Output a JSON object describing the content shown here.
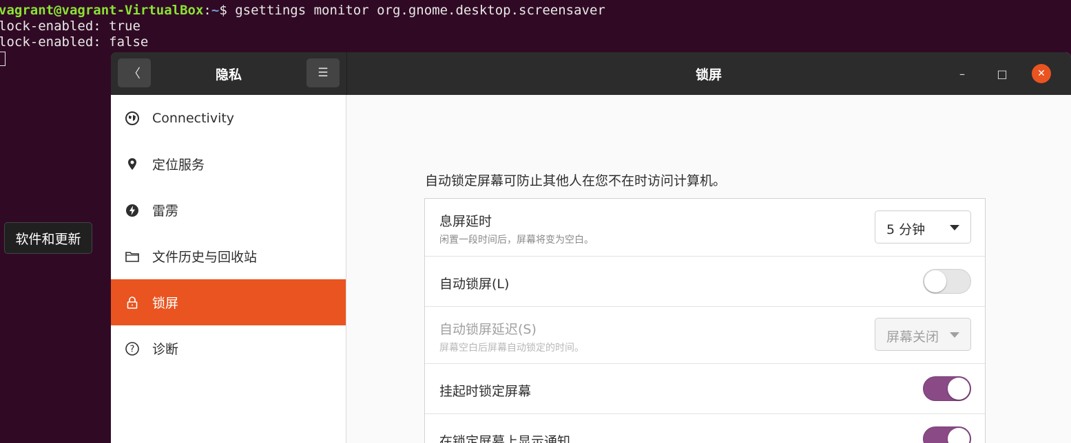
{
  "terminal": {
    "prompt_user": "vagrant@vagrant-VirtualBox",
    "prompt_sep": ":",
    "prompt_path": "~",
    "prompt_command": "$ gsettings monitor org.gnome.desktop.screensaver",
    "output_lines": [
      "lock-enabled: true",
      "lock-enabled: false"
    ]
  },
  "tooltip": {
    "text": "软件和更新"
  },
  "window": {
    "sidebar_title": "隐私",
    "title": "锁屏",
    "back_glyph": "〈",
    "menu_glyph": "☰",
    "min_glyph": "–",
    "max_glyph": "□",
    "close_glyph": "✕"
  },
  "sidebar": {
    "items": [
      {
        "label": "Connectivity",
        "icon": "globe-icon"
      },
      {
        "label": "定位服务",
        "icon": "location-pin-icon"
      },
      {
        "label": "雷雳",
        "icon": "thunderbolt-icon"
      },
      {
        "label": "文件历史与回收站",
        "icon": "folder-icon"
      },
      {
        "label": "锁屏",
        "icon": "lock-icon",
        "active": true
      },
      {
        "label": "诊断",
        "icon": "help-icon"
      }
    ]
  },
  "content": {
    "description": "自动锁定屏幕可防止其他人在您不在时访问计算机。",
    "rows": [
      {
        "title": "息屏延时",
        "subtitle": "闲置一段时间后，屏幕将变为空白。",
        "control": "dropdown",
        "value": "5 分钟"
      },
      {
        "title": "自动锁屏(L)",
        "control": "toggle",
        "on": false
      },
      {
        "title": "自动锁屏延迟(S)",
        "subtitle": "屏幕空白后屏幕自动锁定的时间。",
        "control": "dropdown",
        "value": "屏幕关闭",
        "disabled": true
      },
      {
        "title": "挂起时锁定屏幕",
        "control": "toggle",
        "on": true
      },
      {
        "title": "在锁定屏幕上显示通知",
        "control": "toggle",
        "on": true
      }
    ]
  },
  "colors": {
    "terminal_bg": "#300a24",
    "accent_orange": "#e95420",
    "toggle_on": "#8a4a86"
  }
}
